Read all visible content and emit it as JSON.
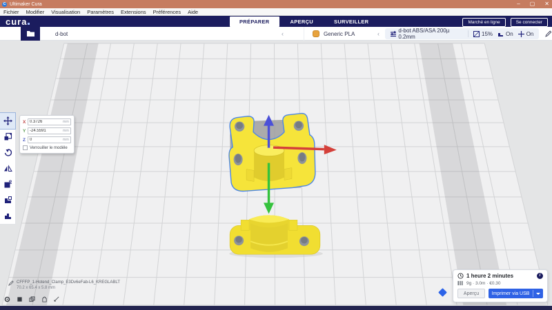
{
  "window": {
    "title": "Ultimaker Cura"
  },
  "menu_bar": {
    "items": [
      "Fichier",
      "Modifier",
      "Visualisation",
      "Paramètres",
      "Extensions",
      "Préférences",
      "Aide"
    ]
  },
  "header": {
    "logo_text": "cura",
    "tabs": [
      {
        "label": "PRÉPARER",
        "active": true
      },
      {
        "label": "APERÇU",
        "active": false
      },
      {
        "label": "SURVEILLER",
        "active": false
      }
    ],
    "marketplace_label": "Marché en ligne",
    "sign_in_label": "Se connecter"
  },
  "config_bar": {
    "printer_name": "d-bot",
    "material_name": "Generic PLA",
    "profile_summary": "d-bot ABS/ASA 200µ 0.2mm",
    "infill_value": "15%",
    "support_value": "On",
    "adhesion_value": "On"
  },
  "toolbar": {
    "tools": [
      "move",
      "scale",
      "rotate",
      "mirror",
      "per-model-settings",
      "support-blocker",
      "mesh-tools"
    ]
  },
  "position_panel": {
    "x_label": "X",
    "x_value": "0.3726",
    "y_label": "Y",
    "y_value": "-24.5591",
    "z_label": "Z",
    "z_value": "0",
    "unit": "mm",
    "lock_label": "Verrouiller le modèle"
  },
  "model_info": {
    "name": "CFFFP_1-Hotend_Clamp_E3Dv6eFab-L6_KREGLABLT",
    "dimensions": "70.2 x 65.4 x 5.8 mm"
  },
  "print_panel": {
    "time_estimate": "1 heure 2 minutes",
    "material_usage": "9g · 3.0m · €0.30",
    "preview_label": "Aperçu",
    "print_label": "Imprimer via USB"
  },
  "colors": {
    "titlebar": "#c67c60",
    "header_navy": "#1b1c5e",
    "accent_blue": "#2f62e5",
    "model_yellow": "#f6e43a",
    "selection_outline": "#4b86e8",
    "axis_x_red": "#d4403a",
    "axis_y_green": "#35c23d",
    "axis_z_blue": "#4b50d8"
  }
}
